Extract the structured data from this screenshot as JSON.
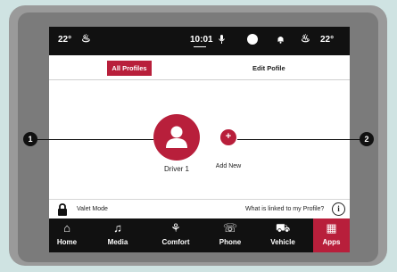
{
  "status_bar": {
    "temp_left": "22°",
    "seat_left_icon": "heated-seat-icon",
    "time": "10:01",
    "mic_icon": "microphone-icon",
    "notification_icon": "bell-icon",
    "seat_right_icon": "heated-seat-icon",
    "temp_right": "22°"
  },
  "tabs": [
    {
      "label": "All Profiles",
      "active": true
    },
    {
      "label": "Edit Pofile",
      "active": false
    }
  ],
  "profiles": {
    "driver_label": "Driver 1",
    "add_symbol": "+",
    "add_label": "Add New"
  },
  "bottom_row": {
    "valet_label": "Valet Mode",
    "linked_label": "What is linked to my Profile?",
    "info_symbol": "i"
  },
  "nav": [
    {
      "label": "Home",
      "icon": "⌂",
      "icon_name": "home-icon"
    },
    {
      "label": "Media",
      "icon": "♫",
      "icon_name": "music-note-icon"
    },
    {
      "label": "Comfort",
      "icon": "⚘",
      "icon_name": "seat-climate-icon"
    },
    {
      "label": "Phone",
      "icon": "☏",
      "icon_name": "phone-icon"
    },
    {
      "label": "Vehicle",
      "icon": "⛟",
      "icon_name": "vehicle-icon"
    },
    {
      "label": "Apps",
      "icon": "▦",
      "icon_name": "apps-grid-icon"
    }
  ],
  "callouts": [
    "1",
    "2"
  ],
  "colors": {
    "accent": "#b81f3b",
    "bar": "#111111",
    "background": "#cfe3e2"
  }
}
